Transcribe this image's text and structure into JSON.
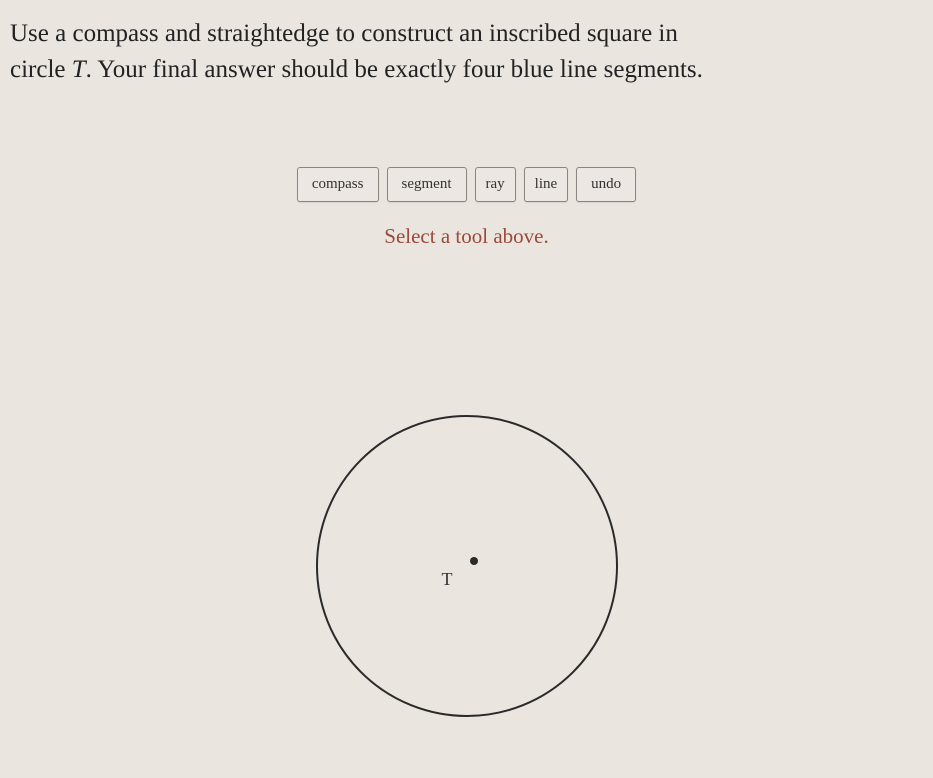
{
  "instructions": {
    "line1_pre": "Use a compass and straightedge to construct an inscribed square in",
    "line2_pre": "circle ",
    "variable": "T",
    "line2_post": ". Your final answer should be exactly four blue line segments."
  },
  "toolbar": {
    "compass": "compass",
    "segment": "segment",
    "ray": "ray",
    "line": "line",
    "undo": "undo"
  },
  "hint": "Select a tool above.",
  "circle": {
    "center_label": "T"
  }
}
